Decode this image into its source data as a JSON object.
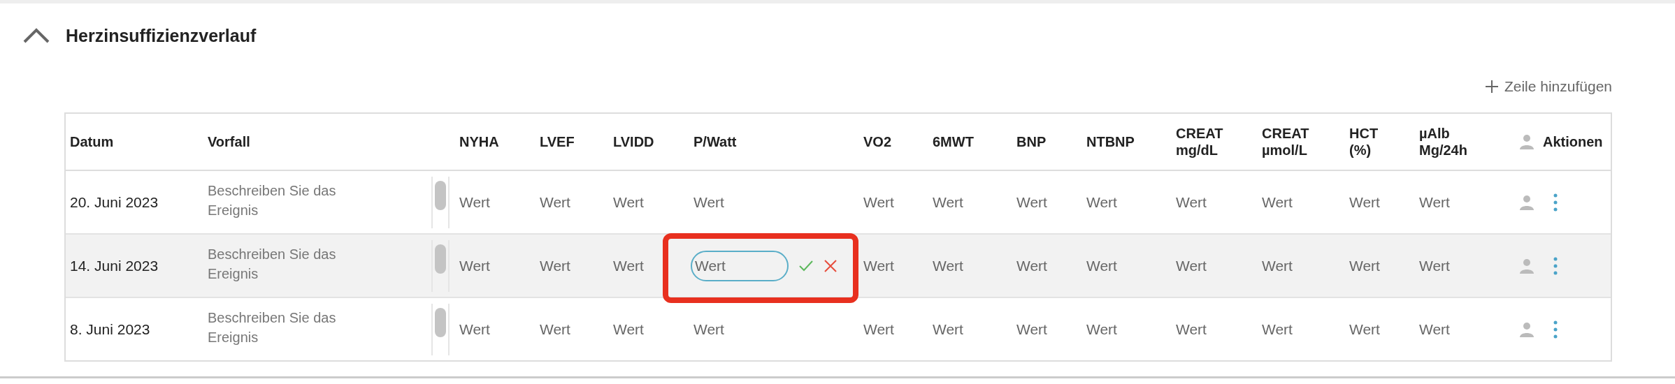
{
  "section": {
    "title": "Herzinsuffizienzverlauf",
    "expanded": true
  },
  "add_row_button": {
    "label": "Zeile hinzufügen"
  },
  "table": {
    "columns": [
      {
        "label": "Datum"
      },
      {
        "label": "Vorfall"
      },
      {
        "label": "NYHA"
      },
      {
        "label": "LVEF"
      },
      {
        "label": "LVIDD"
      },
      {
        "label": "P/Watt"
      },
      {
        "label": "VO2"
      },
      {
        "label": "6MWT"
      },
      {
        "label": "BNP"
      },
      {
        "label": "NTBNP"
      },
      {
        "label": "CREAT\nmg/dL"
      },
      {
        "label": "CREAT\nµmol/L"
      },
      {
        "label": "HCT\n(%)"
      },
      {
        "label": "µAlb\nMg/24h"
      },
      {
        "label": "Aktionen"
      }
    ],
    "rows": [
      {
        "date": "20. Juni 2023",
        "event_placeholder": "Beschreiben Sie das Ereignis",
        "highlighted": false,
        "values": [
          {
            "value": "Wert",
            "editing": false,
            "annotated": false
          },
          {
            "value": "Wert",
            "editing": false,
            "annotated": false
          },
          {
            "value": "Wert",
            "editing": false,
            "annotated": false
          },
          {
            "value": "Wert",
            "editing": false,
            "annotated": false
          },
          {
            "value": "Wert",
            "editing": false,
            "annotated": false
          },
          {
            "value": "Wert",
            "editing": false,
            "annotated": false
          },
          {
            "value": "Wert",
            "editing": false,
            "annotated": false
          },
          {
            "value": "Wert",
            "editing": false,
            "annotated": false
          },
          {
            "value": "Wert",
            "editing": false,
            "annotated": false
          },
          {
            "value": "Wert",
            "editing": false,
            "annotated": false
          },
          {
            "value": "Wert",
            "editing": false,
            "annotated": false
          },
          {
            "value": "Wert",
            "editing": false,
            "annotated": false
          }
        ]
      },
      {
        "date": "14. Juni 2023",
        "event_placeholder": "Beschreiben Sie das Ereignis",
        "highlighted": true,
        "values": [
          {
            "value": "Wert",
            "editing": false,
            "annotated": false
          },
          {
            "value": "Wert",
            "editing": false,
            "annotated": false
          },
          {
            "value": "Wert",
            "editing": false,
            "annotated": false
          },
          {
            "value": "Wert",
            "editing": true,
            "annotated": true
          },
          {
            "value": "Wert",
            "editing": false,
            "annotated": false
          },
          {
            "value": "Wert",
            "editing": false,
            "annotated": false
          },
          {
            "value": "Wert",
            "editing": false,
            "annotated": false
          },
          {
            "value": "Wert",
            "editing": false,
            "annotated": false
          },
          {
            "value": "Wert",
            "editing": false,
            "annotated": false
          },
          {
            "value": "Wert",
            "editing": false,
            "annotated": false
          },
          {
            "value": "Wert",
            "editing": false,
            "annotated": false
          },
          {
            "value": "Wert",
            "editing": false,
            "annotated": false
          }
        ]
      },
      {
        "date": "8. Juni 2023",
        "event_placeholder": "Beschreiben Sie das Ereignis",
        "highlighted": false,
        "values": [
          {
            "value": "Wert",
            "editing": false,
            "annotated": false
          },
          {
            "value": "Wert",
            "editing": false,
            "annotated": false
          },
          {
            "value": "Wert",
            "editing": false,
            "annotated": false
          },
          {
            "value": "Wert",
            "editing": false,
            "annotated": false
          },
          {
            "value": "Wert",
            "editing": false,
            "annotated": false
          },
          {
            "value": "Wert",
            "editing": false,
            "annotated": false
          },
          {
            "value": "Wert",
            "editing": false,
            "annotated": false
          },
          {
            "value": "Wert",
            "editing": false,
            "annotated": false
          },
          {
            "value": "Wert",
            "editing": false,
            "annotated": false
          },
          {
            "value": "Wert",
            "editing": false,
            "annotated": false
          },
          {
            "value": "Wert",
            "editing": false,
            "annotated": false
          },
          {
            "value": "Wert",
            "editing": false,
            "annotated": false
          }
        ]
      }
    ]
  }
}
